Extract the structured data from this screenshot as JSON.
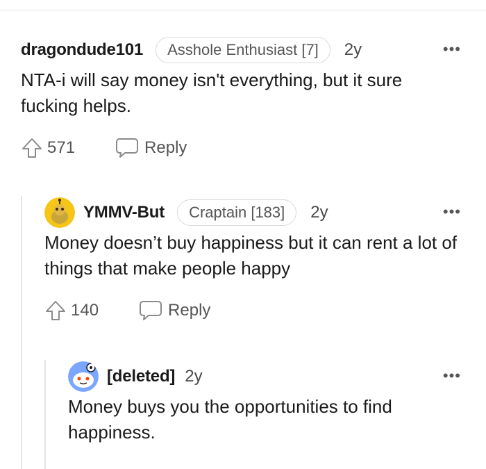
{
  "comments": [
    {
      "username": "dragondude101",
      "flair": "Asshole Enthusiast [7]",
      "age": "2y",
      "body": "NTA-i will say money isn't everything, but it sure fucking helps.",
      "votes": "571",
      "reply_label": "Reply",
      "more_icon": "more-options-icon"
    },
    {
      "username": "YMMV-But",
      "flair": "Craptain [183]",
      "age": "2y",
      "body": "Money doesn’t buy happiness but it can rent a lot of things that make people happy",
      "votes": "140",
      "reply_label": "Reply",
      "avatar_color": "#f5c518",
      "more_icon": "more-options-icon"
    },
    {
      "username": "[deleted]",
      "age": "2y",
      "body": "Money buys you the opportunities to find happiness.",
      "avatar_color": "#7aa6ff",
      "more_icon": "more-options-icon"
    }
  ],
  "colors": {
    "text": "#1a1a1b",
    "muted": "#555555",
    "thread_line": "#e4e4e4"
  }
}
